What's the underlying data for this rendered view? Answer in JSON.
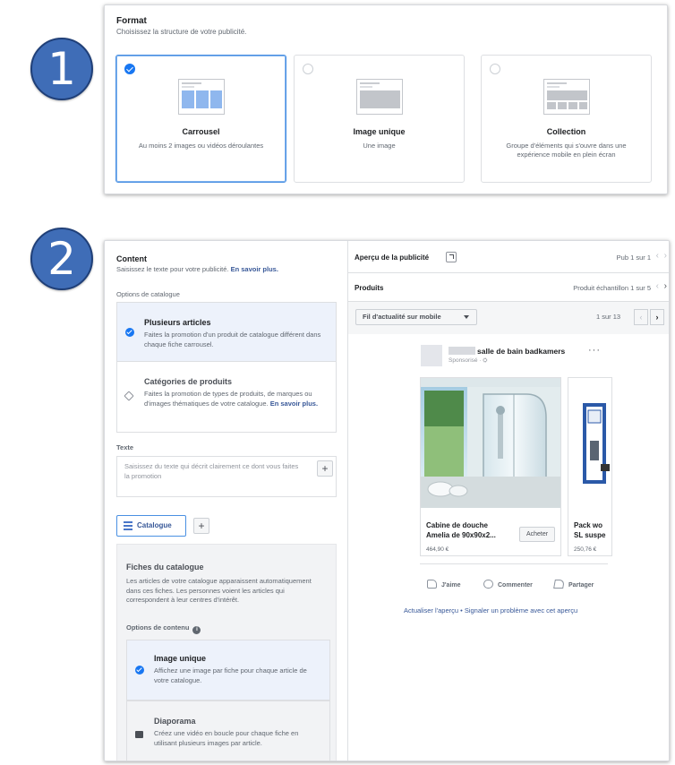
{
  "steps": {
    "one": "1",
    "two": "2"
  },
  "format": {
    "title": "Format",
    "subtitle": "Choisissez la structure de votre publicité.",
    "options": [
      {
        "label": "Carrousel",
        "description": "Au moins 2 images ou vidéos déroulantes",
        "selected": true
      },
      {
        "label": "Image unique",
        "description": "Une image",
        "selected": false
      },
      {
        "label": "Collection",
        "description": "Groupe d'éléments qui s'ouvre dans une expérience mobile en plein écran",
        "selected": false
      }
    ]
  },
  "content": {
    "title": "Content",
    "subtitle_text": "Saisissez le texte pour votre publicité.",
    "subtitle_link": "En savoir plus.",
    "catalog_options_label": "Options de catalogue",
    "catalog_options": [
      {
        "name": "Plusieurs articles",
        "description": "Faites la promotion d'un produit de catalogue différent dans chaque fiche carrousel.",
        "selected": true,
        "icon": "check-icon"
      },
      {
        "name": "Catégories de produits",
        "description_text": "Faites la promotion de types de produits, de marques ou d'images thématiques de votre catalogue.",
        "description_link": "En savoir plus.",
        "selected": false,
        "icon": "tag-icon"
      }
    ],
    "text_label": "Texte",
    "text_placeholder": "Saisissez du texte qui décrit clairement ce dont vous faites la promotion",
    "plus_symbol": "+",
    "tab_catalog": "Catalogue",
    "fiches": {
      "title": "Fiches du catalogue",
      "description": "Les articles de votre catalogue apparaissent automatiquement dans ces fiches. Les personnes voient les articles qui correspondent à leur centres d'intérêt.",
      "content_options_label": "Options de contenu",
      "info_symbol": "i",
      "options": [
        {
          "name": "Image unique",
          "description": "Affichez une image par fiche pour chaque article de votre catalogue.",
          "selected": true,
          "icon": "check-icon"
        },
        {
          "name": "Diaporama",
          "description": "Créez une vidéo en boucle pour chaque fiche en utilisant plusieurs images par article.",
          "selected": false,
          "icon": "stack-icon"
        }
      ]
    }
  },
  "preview": {
    "title": "Aperçu de la publicité",
    "pub_counter": "Pub 1 sur 1",
    "products_label": "Produits",
    "sample_counter": "Produit échantillon 1 sur 5",
    "placement": "Fil d'actualité sur mobile",
    "page_counter": "1 sur 13",
    "chevron_left": "‹",
    "chevron_right": "›",
    "post": {
      "page_name": "salle de bain badkamers",
      "sponsored": "Sponsorisé · ⛭",
      "more": "···",
      "cards": [
        {
          "title_line1": "Cabine de douche",
          "title_line2": "Amelia de 90x90x2...",
          "price": "464,90 €",
          "cta": "Acheter"
        },
        {
          "title_line1": "Pack wo",
          "title_line2": "SL suspe",
          "price": "250,76 €"
        }
      ],
      "like": "J'aime",
      "comment": "Commenter",
      "share": "Partager"
    },
    "footer_refresh": "Actualiser l'aperçu",
    "footer_sep": " • ",
    "footer_report": "Signaler un problème avec cet aperçu"
  },
  "colors": {
    "accent": "#1877f2",
    "link": "#385898",
    "badge": "#3f6db7",
    "selected_bg": "#edf2fb"
  }
}
